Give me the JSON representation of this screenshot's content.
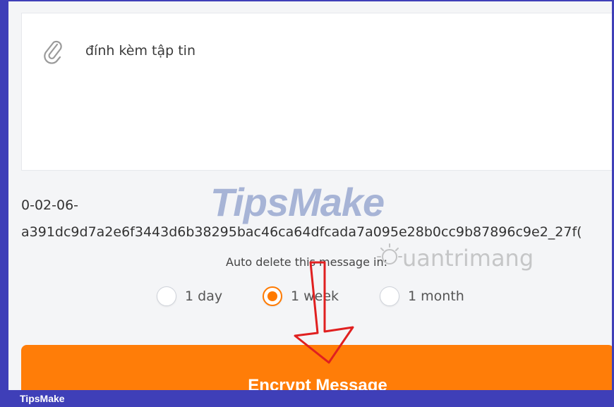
{
  "attachment": {
    "icon": "paperclip-icon",
    "label": "đính kèm tập tin"
  },
  "message_code": {
    "prefix": "0-02-06-",
    "hash": "a391dc9d7a2e6f3443d6b38295bac46ca64dfcada7a095e28b0cc9b87896c9e2_27f("
  },
  "auto_delete": {
    "label": "Auto delete this message in:",
    "options": [
      {
        "label": "1 day",
        "selected": false
      },
      {
        "label": "1 week",
        "selected": true
      },
      {
        "label": "1 month",
        "selected": false
      }
    ]
  },
  "encrypt_button": {
    "label": "Encrypt Message"
  },
  "watermarks": {
    "tipsmake": "TipsMake",
    "quantrimang": "uantrimang"
  },
  "footer": {
    "brand": "TipsMake"
  },
  "colors": {
    "accent": "#ff7d08",
    "frame": "#3f3fb8",
    "annotation_arrow": "#e02020"
  }
}
